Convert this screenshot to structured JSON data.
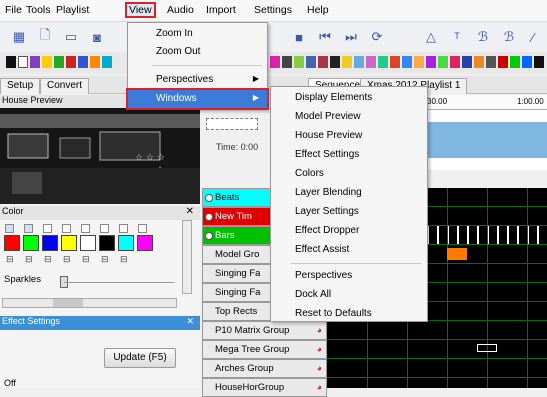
{
  "menubar": {
    "items": [
      {
        "label": "File"
      },
      {
        "label": "Tools"
      },
      {
        "label": "Playlist"
      },
      {
        "label": "View"
      },
      {
        "label": "Audio"
      },
      {
        "label": "Import"
      },
      {
        "label": "Settings"
      },
      {
        "label": "Help"
      }
    ]
  },
  "view_menu": {
    "zoom_in": "Zoom In",
    "zoom_out": "Zoom Out",
    "perspectives": "Perspectives",
    "windows": "Windows"
  },
  "windows_menu": {
    "items": [
      "Display Elements",
      "Model Preview",
      "House Preview",
      "Effect Settings",
      "Colors",
      "Layer Blending",
      "Layer Settings",
      "Effect Dropper",
      "Effect Assist"
    ],
    "items2": [
      "Perspectives",
      "Dock All",
      "Reset to Defaults"
    ]
  },
  "tabs": {
    "setup": "Setup",
    "convert": "Convert",
    "sequencer": "Sequencer",
    "playlist": "Xmas 2012 Playlist 1"
  },
  "panels": {
    "house_preview": "House Preview",
    "color": "Color",
    "sparkles": "Sparkles",
    "effect_settings": "Effect Settings",
    "update_button": "Update (F5)",
    "off_label": "Off"
  },
  "sequencer": {
    "time_label": "Time: 0:00",
    "ruler_ticks": [
      "30.00",
      "1:00.00"
    ]
  },
  "rows": [
    "Beats",
    "New Tim",
    "Bars",
    "Model Gro",
    "Singing Fa",
    "Singing Fa",
    "Top Rects",
    "P10 Matrix Group",
    "Mega Tree Group",
    "Arches Group",
    "HouseHorGroup"
  ],
  "colors": {
    "accent": "#3c7cd8",
    "highlight_border": "#d6242a",
    "swatches": [
      "#ff0000",
      "#00ff00",
      "#0000ff",
      "#ffff00",
      "#000000",
      "#00ffff",
      "#ff00ff",
      "#ffffff"
    ]
  }
}
